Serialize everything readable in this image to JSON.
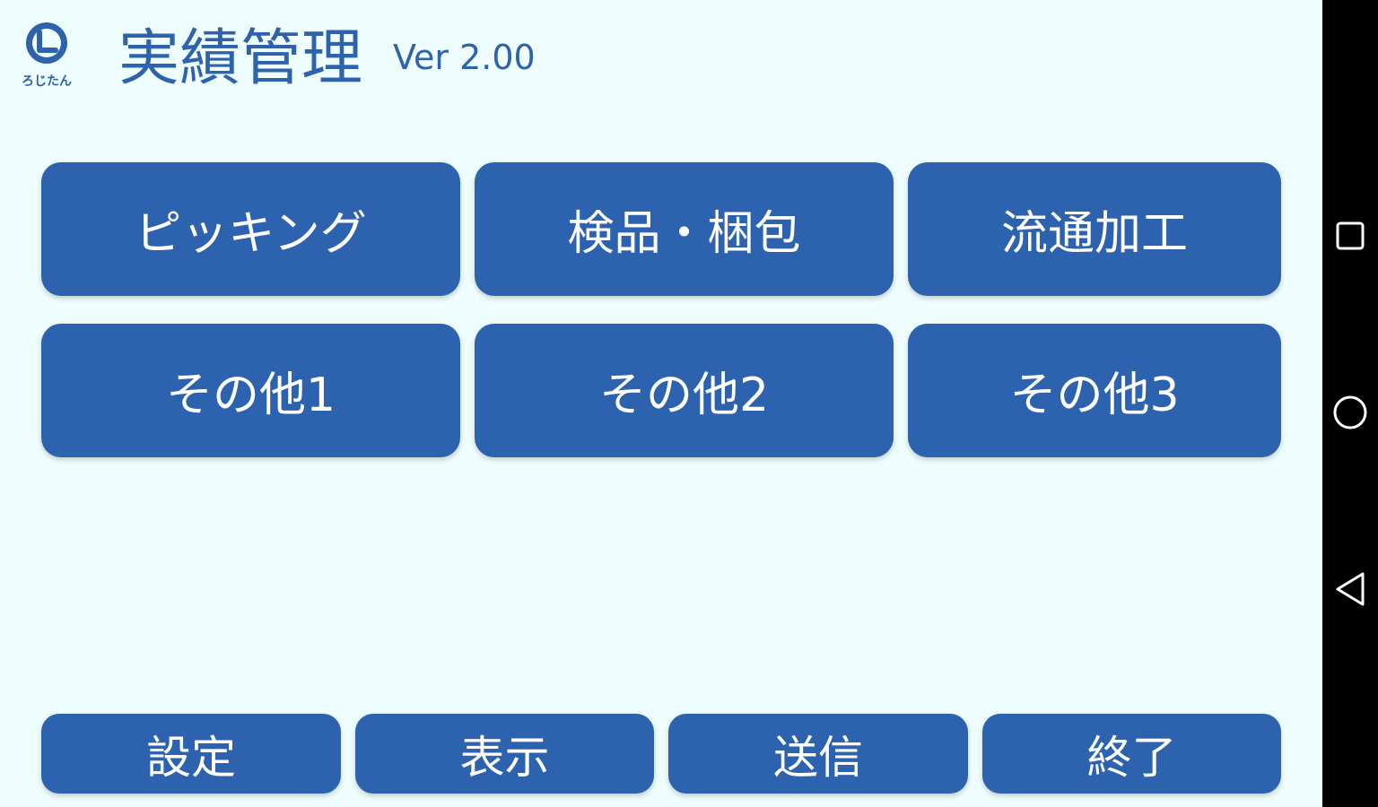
{
  "header": {
    "logo_text": "ろじたん",
    "title": "実績管理",
    "version": "Ver 2.00"
  },
  "main_buttons": [
    "ピッキング",
    "検品・梱包",
    "流通加工",
    "その他1",
    "その他2",
    "その他3"
  ],
  "bottom_buttons": [
    "設定",
    "表示",
    "送信",
    "終了"
  ],
  "navbar": {
    "icons": [
      "recents-square-icon",
      "home-circle-icon",
      "back-triangle-icon"
    ]
  },
  "colors": {
    "background": "#eefdfd",
    "accent": "#2d63ae",
    "navbar": "#000000"
  }
}
